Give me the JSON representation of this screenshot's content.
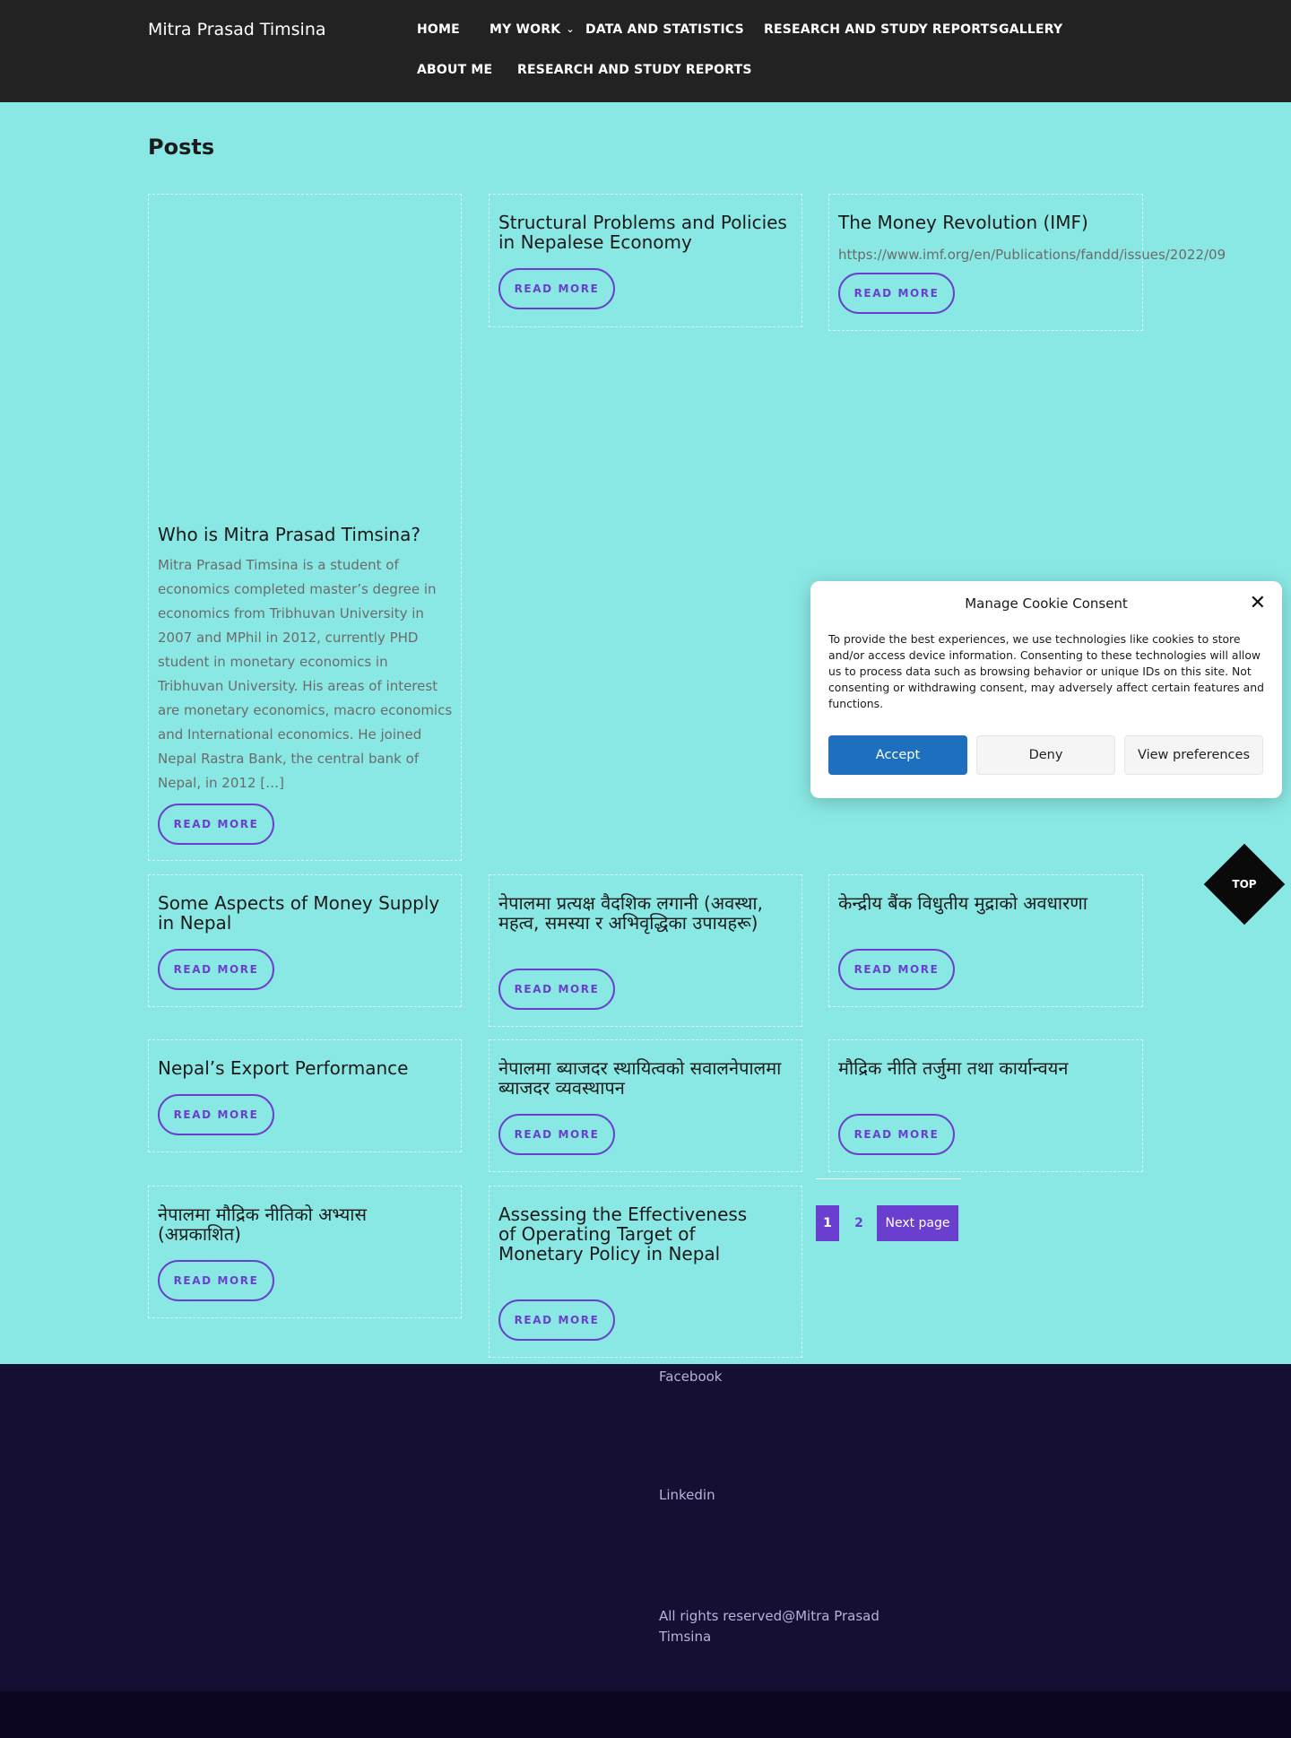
{
  "header": {
    "site_title": "Mitra Prasad Timsina",
    "nav": [
      {
        "label": "HOME"
      },
      {
        "label": "MY WORK",
        "has_dropdown": true
      },
      {
        "label": "DATA AND STATISTICS"
      },
      {
        "label": "RESEARCH AND STUDY REPORTS"
      },
      {
        "label": "GALLERY"
      },
      {
        "label": "ABOUT ME"
      },
      {
        "label": "RESEARCH AND STUDY REPORTS"
      }
    ]
  },
  "main": {
    "page_title": "Posts",
    "read_more_label": "READ MORE",
    "posts": [
      {
        "title": "Who is Mitra Prasad Timsina?",
        "excerpt": "Mitra Prasad Timsina is a student of economics completed master’s degree in economics from Tribhuvan University in 2007 and MPhil in 2012, currently PHD student in monetary economics in Tribhuvan University. His areas of interest are monetary economics, macro economics and International economics. He joined Nepal Rastra Bank, the central bank of Nepal, in 2012 […]"
      },
      {
        "title": "Structural Problems and Policies in Nepalese Economy"
      },
      {
        "title": "The Money Revolution (IMF)",
        "excerpt": "https://www.imf.org/en/Publications/fandd/issues/2022/09"
      },
      {
        "title": "Some Aspects of Money Supply in Nepal"
      },
      {
        "title": "नेपालमा प्रत्यक्ष वैदशिक लगानी (अवस्था, महत्व, समस्या र अभिवृद्धिका उपायहरू)"
      },
      {
        "title": "केन्द्रीय बैंक विधुतीय मुद्राको अवधारणा"
      },
      {
        "title": "Nepal’s Export Performance"
      },
      {
        "title": "नेपालमा ब्याजदर स्थायित्वको सवालनेपालमा ब्याजदर व्यवस्थापन"
      },
      {
        "title": "मौद्रिक नीति तर्जुमा तथा कार्यान्वयन"
      },
      {
        "title": "नेपालमा मौद्रिक नीतिको अभ्यास (अप्रकाशित)"
      },
      {
        "title": "Assessing the Effectiveness of Operating Target of Monetary Policy in Nepal"
      }
    ],
    "pagination": {
      "current": "1",
      "next_num": "2",
      "next_label": "Next page"
    }
  },
  "top_button": {
    "label": "TOP"
  },
  "footer": {
    "links": [
      {
        "label": "Facebook"
      },
      {
        "label": "Linkedin"
      }
    ],
    "copyright": "All rights reserved@Mitra Prasad Timsina"
  },
  "cookie_modal": {
    "title": "Manage Cookie Consent",
    "text": "To provide the best experiences, we use technologies like cookies to store and/or access device information. Consenting to these technologies will allow us to process data such as browsing behavior or unique IDs on this site. Not consenting or withdrawing consent, may adversely affect certain features and functions.",
    "accept_label": "Accept",
    "deny_label": "Deny",
    "prefs_label": "View preferences",
    "accent_color": "#1e6fbe"
  },
  "colors": {
    "header_bg": "#222222",
    "page_bg": "#8ae8e4",
    "accent": "#6a3fd0",
    "footer_bg": "#160f34"
  }
}
